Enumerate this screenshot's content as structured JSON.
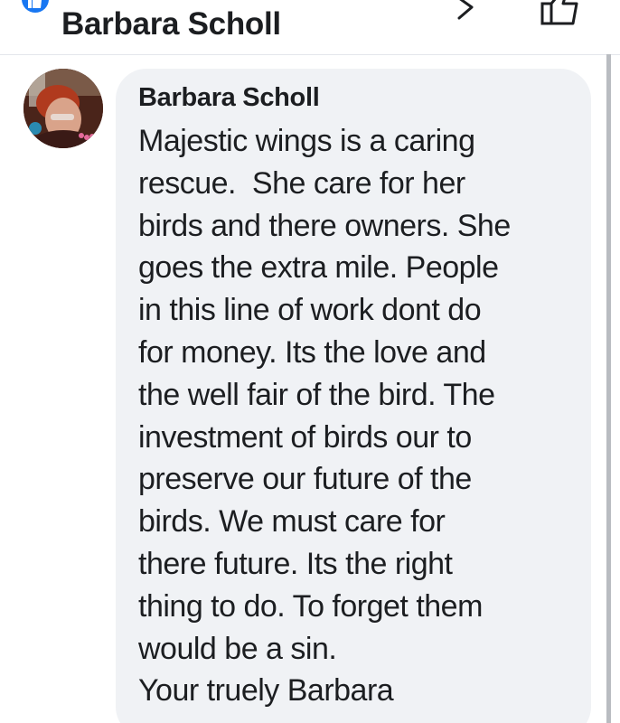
{
  "header": {
    "title": "Barbara Scholl"
  },
  "comment": {
    "author": "Barbara Scholl",
    "lines": [
      "Majestic wings is a caring",
      "rescue.  She care for her",
      "birds and there owners. She",
      "goes the extra mile. People",
      "in this line of work dont do",
      "for money. Its the love and",
      "the well fair of the bird. The",
      "investment of birds our to",
      "preserve our future of the",
      "birds. We must care for",
      "there future. Its the right",
      "thing to do. To forget them",
      "would be a sin.",
      "Your truely Barbara"
    ]
  },
  "colors": {
    "accent": "#1877f2",
    "bubble": "#f0f2f5",
    "text": "#1c1e21"
  },
  "icons": {
    "like_badge": "like-icon",
    "chevron": "chevron-right-icon",
    "thumb": "thumbs-up-icon"
  }
}
